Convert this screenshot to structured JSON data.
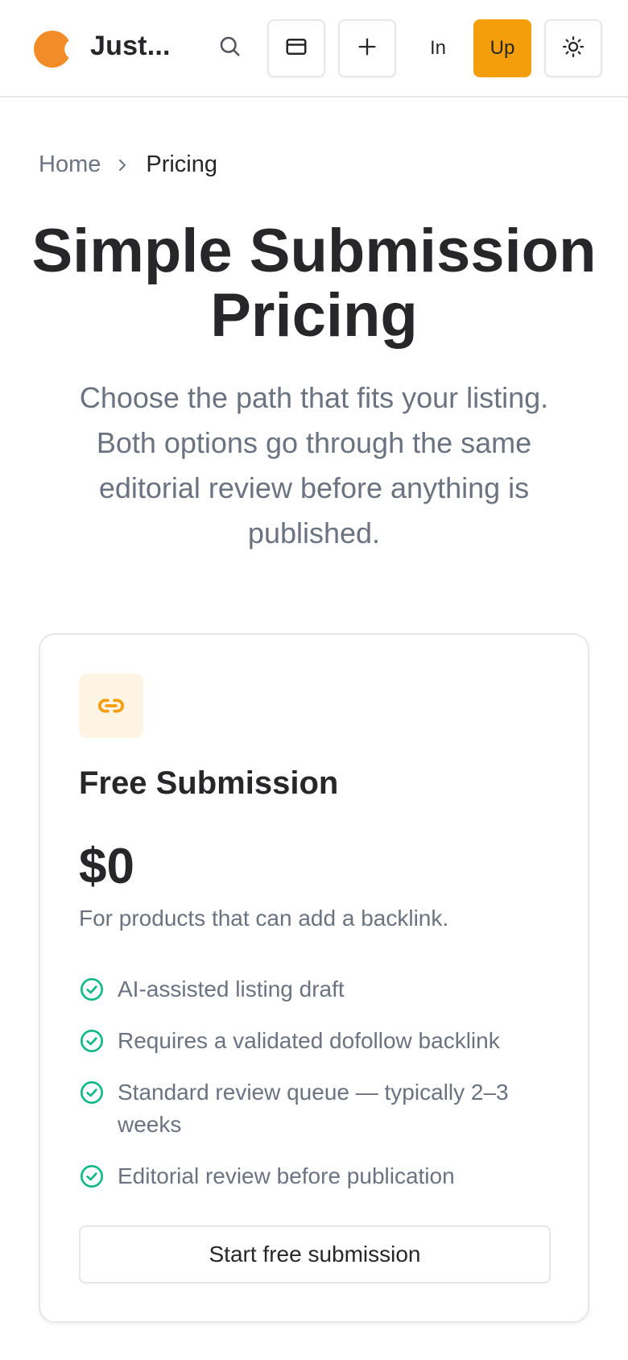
{
  "colors": {
    "accent": "#f59e0b",
    "logo": "#f28c28",
    "check": "#10b981",
    "text_dark": "#27272a",
    "text_muted": "#6b7280",
    "border": "#e5e7eb",
    "icon_tile_bg": "#fef4e4"
  },
  "header": {
    "brand": "Just...",
    "icons": {
      "logo": "logo-mark",
      "search": "search-icon",
      "card": "credit-card-icon",
      "plus": "plus-icon",
      "theme": "sun-icon"
    },
    "sign_in_label": "In",
    "sign_up_label": "Up"
  },
  "breadcrumb": {
    "home": "Home",
    "current": "Pricing"
  },
  "hero": {
    "title": "Simple Submission Pricing",
    "subtitle": "Choose the path that fits your listing. Both options go through the same editorial review before anything is published."
  },
  "plan": {
    "icon": "link-icon",
    "title": "Free Submission",
    "price": "$0",
    "description": "For products that can add a backlink.",
    "features": [
      "AI-assisted listing draft",
      "Requires a validated dofollow backlink",
      "Standard review queue — typically 2–3 weeks",
      "Editorial review before publication"
    ],
    "cta": "Start free submission"
  }
}
